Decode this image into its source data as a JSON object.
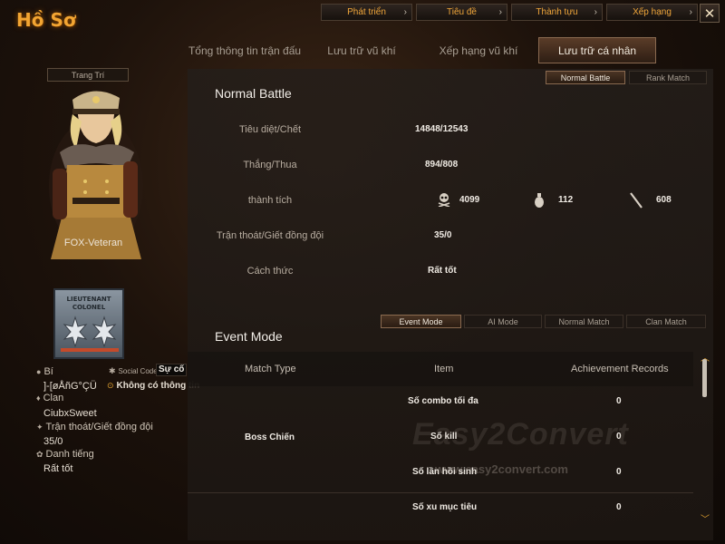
{
  "window": {
    "title": "Hồ Sơ"
  },
  "top_nav": [
    {
      "label": "Phát triển"
    },
    {
      "label": "Tiêu đề"
    },
    {
      "label": "Thành tựu"
    },
    {
      "label": "Xếp hạng"
    }
  ],
  "close_label": "✕",
  "tabs": [
    {
      "label": "Tổng thông tin trận đấu"
    },
    {
      "label": "Lưu trữ vũ khí"
    },
    {
      "label": "Xếp hạng vũ khí"
    },
    {
      "label": "Lưu trữ cá nhân",
      "active": true
    }
  ],
  "profile": {
    "decoration_label": "Trang Trí",
    "character_name": "FOX-Veteran",
    "rank_badge_text": "LIEUTENANT COLONEL",
    "name_label": "Bí",
    "name_value": "]-[øÅñG°ÇÜ",
    "social_label": "Social Code",
    "social_value": "Sự cố",
    "social_status": "Không có thông tin",
    "clan_label": "Clan",
    "clan_value": "CiubxSweet",
    "escape_label": "Trận thoát/Giết đồng đội",
    "escape_value": "35/0",
    "reputation_label": "Danh tiếng",
    "reputation_value": "Rất tốt"
  },
  "battle_tabs": [
    {
      "label": "Normal Battle",
      "active": true
    },
    {
      "label": "Rank Match"
    }
  ],
  "normal_battle": {
    "title": "Normal Battle",
    "stats": [
      {
        "label": "Tiêu diệt/Chết",
        "value": "14848/12543"
      },
      {
        "label": "Thắng/Thua",
        "value": "894/808"
      },
      {
        "label": "thành tích",
        "achievements": {
          "skull": "4099",
          "grenade": "112",
          "knife": "608"
        }
      },
      {
        "label": "Trận thoát/Giết đồng đội",
        "value": "35/0"
      },
      {
        "label": "Cách thức",
        "value": "Rất tốt"
      }
    ]
  },
  "mode_tabs": [
    {
      "label": "Event Mode",
      "active": true
    },
    {
      "label": "AI Mode"
    },
    {
      "label": "Normal Match"
    },
    {
      "label": "Clan Match"
    }
  ],
  "event_mode": {
    "title": "Event Mode",
    "headers": [
      "Match Type",
      "Item",
      "Achievement Records"
    ],
    "match_type": "Boss Chiến",
    "rows": [
      {
        "item": "Số combo tối đa",
        "value": "0"
      },
      {
        "item": "Số kill",
        "value": "0"
      },
      {
        "item": "Số lần hồi sinh",
        "value": "0"
      },
      {
        "item": "Số xu mục tiêu",
        "value": "0"
      }
    ]
  },
  "watermark": {
    "text": "Easy2Convert",
    "url": "www.easy2convert.com"
  },
  "colors": {
    "accent": "#f2a532",
    "active_tab": "#5a3c28",
    "text": "#d8d0c4"
  }
}
